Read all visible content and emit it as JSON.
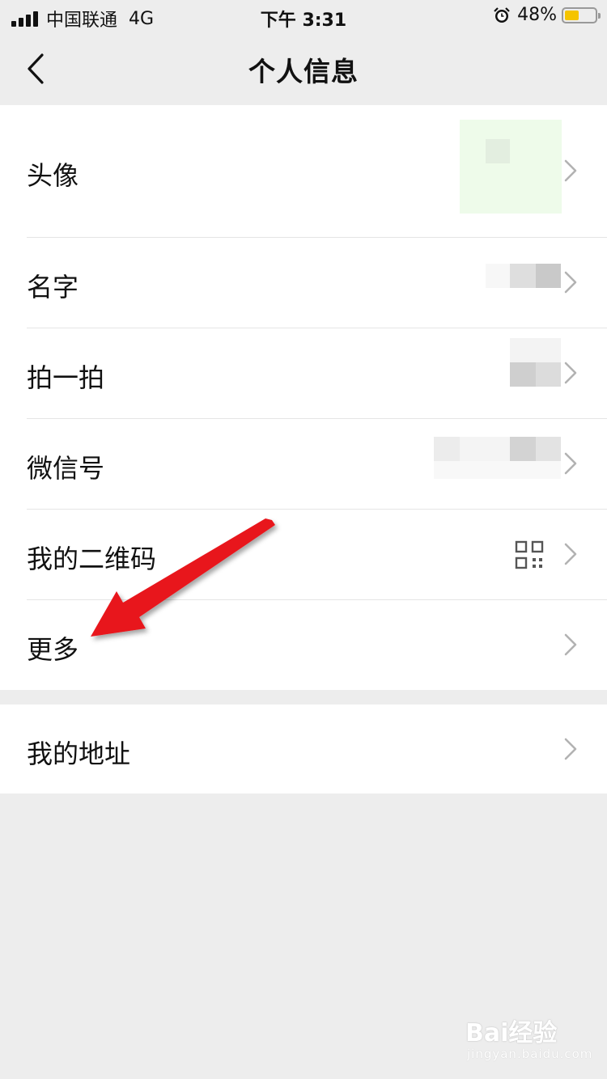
{
  "status_bar": {
    "carrier": "中国联通",
    "network": "4G",
    "time": "下午 3:31",
    "battery_percent_text": "48%",
    "battery_level": 0.48,
    "battery_color": "#f5c400"
  },
  "nav": {
    "title": "个人信息",
    "back_icon": "chevron-left-icon"
  },
  "profile_rows": [
    {
      "label": "头像"
    },
    {
      "label": "名字"
    },
    {
      "label": "拍一拍"
    },
    {
      "label": "微信号"
    },
    {
      "label": "我的二维码"
    },
    {
      "label": "更多"
    }
  ],
  "address_row": {
    "label": "我的地址"
  },
  "annotation": {
    "arrow_color": "#e8141b"
  },
  "watermark": {
    "logo": "Bai经验",
    "sub": "jingyan.baidu.com"
  },
  "colors": {
    "background": "#ededed",
    "row_background": "#ffffff",
    "chevron": "#b2b2b2"
  }
}
